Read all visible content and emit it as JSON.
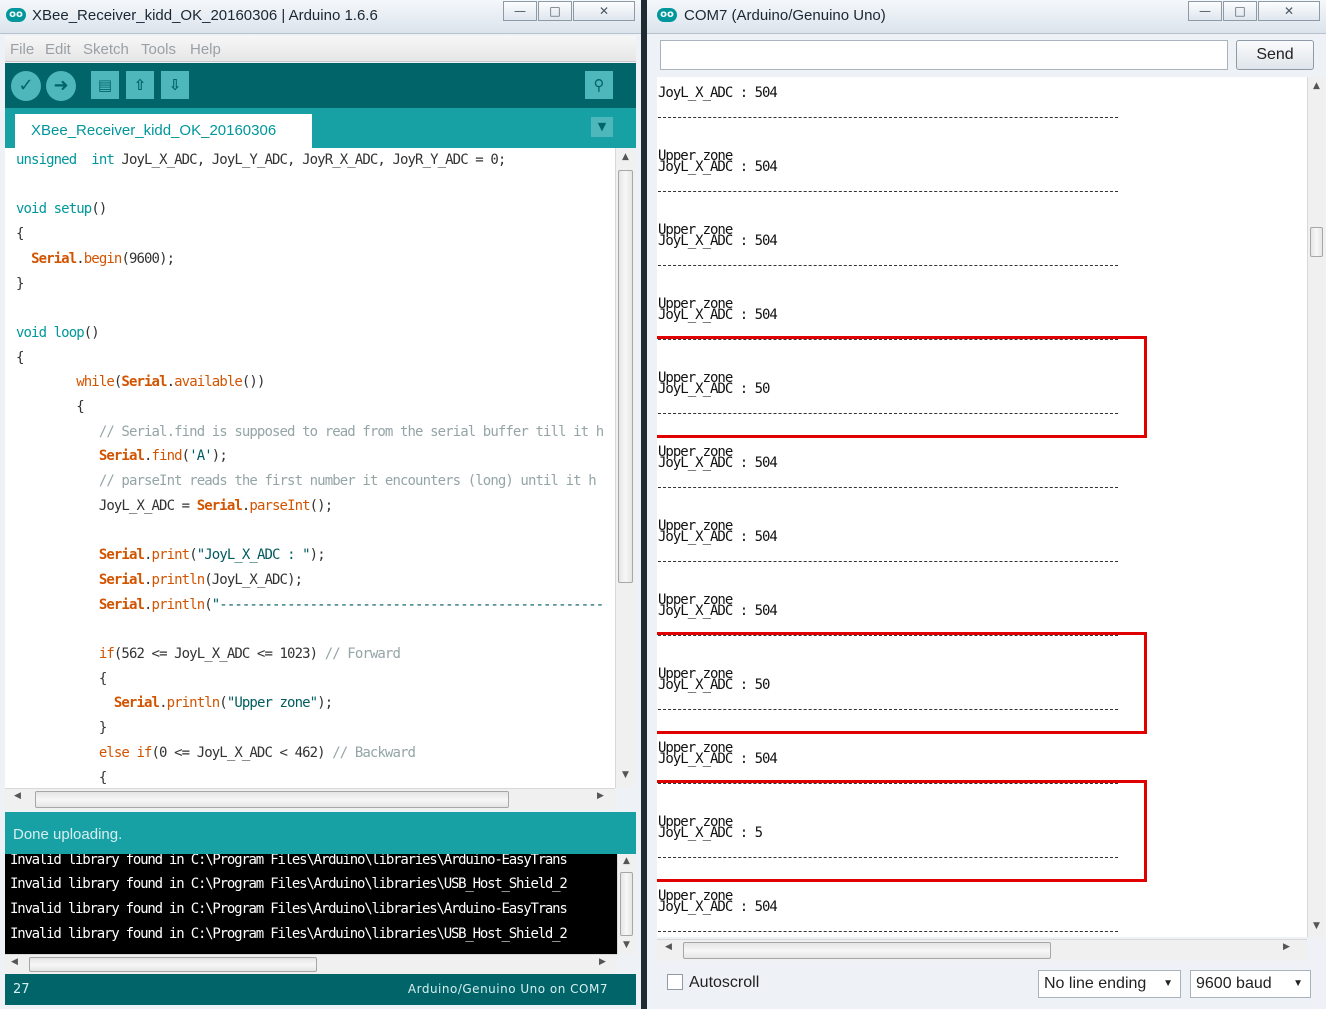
{
  "ide": {
    "title": "XBee_Receiver_kidd_OK_20160306 | Arduino 1.6.6",
    "logo": "oo",
    "menu": [
      "File",
      "Edit",
      "Sketch",
      "Tools",
      "Help"
    ],
    "toolbar_icons": [
      "verify-icon",
      "upload-icon",
      "new-icon",
      "open-icon",
      "save-icon",
      "serial-monitor-icon"
    ],
    "tab": "XBee_Receiver_kidd_OK_20160306",
    "code": [
      [
        [
          "kw",
          "unsigned"
        ],
        [
          "",
          "  "
        ],
        [
          "kw",
          "int"
        ],
        [
          "",
          " JoyL_X_ADC, JoyL_Y_ADC, JoyR_X_ADC, JoyR_Y_ADC = 0;"
        ]
      ],
      [],
      [
        [
          "kw",
          "void"
        ],
        [
          "",
          " "
        ],
        [
          "kw",
          "setup"
        ],
        [
          "",
          "()"
        ]
      ],
      [
        [
          "",
          "{"
        ]
      ],
      [
        [
          "",
          "  "
        ],
        [
          "obj",
          "Serial"
        ],
        [
          "",
          "."
        ],
        [
          "fn",
          "begin"
        ],
        [
          "",
          "(9600);"
        ]
      ],
      [
        [
          "",
          "}"
        ]
      ],
      [],
      [
        [
          "kw",
          "void"
        ],
        [
          "",
          " "
        ],
        [
          "kw",
          "loop"
        ],
        [
          "",
          "()"
        ]
      ],
      [
        [
          "",
          "{"
        ]
      ],
      [
        [
          "",
          "        "
        ],
        [
          "fn",
          "while"
        ],
        [
          "",
          "("
        ],
        [
          "obj",
          "Serial"
        ],
        [
          "",
          "."
        ],
        [
          "fn",
          "available"
        ],
        [
          "",
          "())"
        ]
      ],
      [
        [
          "",
          "        {"
        ]
      ],
      [
        [
          "",
          "           "
        ],
        [
          "cmt",
          "// Serial.find is supposed to read from the serial buffer till it h"
        ]
      ],
      [
        [
          "",
          "           "
        ],
        [
          "obj",
          "Serial"
        ],
        [
          "",
          "."
        ],
        [
          "fn",
          "find"
        ],
        [
          "",
          "("
        ],
        [
          "str",
          "'A'"
        ],
        [
          "",
          ");"
        ]
      ],
      [
        [
          "",
          "           "
        ],
        [
          "cmt",
          "// parseInt reads the first number it encounters (long) until it h"
        ]
      ],
      [
        [
          "",
          "           JoyL_X_ADC = "
        ],
        [
          "obj",
          "Serial"
        ],
        [
          "",
          "."
        ],
        [
          "fn",
          "parseInt"
        ],
        [
          "",
          "();"
        ]
      ],
      [],
      [
        [
          "",
          "           "
        ],
        [
          "obj",
          "Serial"
        ],
        [
          "",
          "."
        ],
        [
          "fn",
          "print"
        ],
        [
          "",
          "("
        ],
        [
          "str",
          "\"JoyL_X_ADC : \""
        ],
        [
          "",
          ");"
        ]
      ],
      [
        [
          "",
          "           "
        ],
        [
          "obj",
          "Serial"
        ],
        [
          "",
          "."
        ],
        [
          "fn",
          "println"
        ],
        [
          "",
          "(JoyL_X_ADC);"
        ]
      ],
      [
        [
          "",
          "           "
        ],
        [
          "obj",
          "Serial"
        ],
        [
          "",
          "."
        ],
        [
          "fn",
          "println"
        ],
        [
          "",
          "("
        ],
        [
          "str",
          "\"---------------------------------------------------"
        ]
      ],
      [],
      [
        [
          "",
          "           "
        ],
        [
          "fn",
          "if"
        ],
        [
          "",
          "(562 <= JoyL_X_ADC <= 1023) "
        ],
        [
          "cmt",
          "// Forward"
        ]
      ],
      [
        [
          "",
          "           {"
        ]
      ],
      [
        [
          "",
          "             "
        ],
        [
          "obj",
          "Serial"
        ],
        [
          "",
          "."
        ],
        [
          "fn",
          "println"
        ],
        [
          "",
          "("
        ],
        [
          "str",
          "\"Upper zone\""
        ],
        [
          "",
          ");"
        ]
      ],
      [
        [
          "",
          "           }"
        ]
      ],
      [
        [
          "",
          "           "
        ],
        [
          "fn",
          "else if"
        ],
        [
          "",
          "(0 <= JoyL_X_ADC < 462) "
        ],
        [
          "cmt",
          "// Backward"
        ]
      ],
      [
        [
          "",
          "           {"
        ]
      ]
    ],
    "status": "Done uploading.",
    "console": [
      "Invalid library found in C:\\Program Files\\Arduino\\libraries\\Arduino-EasyTrans",
      "Invalid library found in C:\\Program Files\\Arduino\\libraries\\USB_Host_Shield_2",
      "Invalid library found in C:\\Program Files\\Arduino\\libraries\\Arduino-EasyTrans",
      "Invalid library found in C:\\Program Files\\Arduino\\libraries\\USB_Host_Shield_2"
    ],
    "line_number": "27",
    "board": "Arduino/Genuino Uno on COM7"
  },
  "serial": {
    "title": "COM7 (Arduino/Genuino Uno)",
    "logo": "oo",
    "input_value": "",
    "send_label": "Send",
    "dash_text": "-----------------------------------------------------",
    "output": [
      {
        "zone": "",
        "adc": "JoyL_X_ADC : 504"
      },
      {
        "zone": "Upper zone",
        "adc": "JoyL_X_ADC : 504"
      },
      {
        "zone": "Upper zone",
        "adc": "JoyL_X_ADC : 504"
      },
      {
        "zone": "Upper zone",
        "adc": "JoyL_X_ADC : 504"
      },
      {
        "zone": "Upper zone",
        "adc": "JoyL_X_ADC : 50"
      },
      {
        "zone": "Upper zone",
        "adc": "JoyL_X_ADC : 504"
      },
      {
        "zone": "Upper zone",
        "adc": "JoyL_X_ADC : 504"
      },
      {
        "zone": "Upper zone",
        "adc": "JoyL_X_ADC : 504"
      },
      {
        "zone": "Upper zone",
        "adc": "JoyL_X_ADC : 50"
      },
      {
        "zone": "Upper zone",
        "adc": "JoyL_X_ADC : 504"
      },
      {
        "zone": "Upper zone",
        "adc": "JoyL_X_ADC : 5"
      },
      {
        "zone": "Upper zone",
        "adc": "JoyL_X_ADC : 504"
      }
    ],
    "highlighted_blocks": [
      4,
      8,
      10
    ],
    "autoscroll_label": "Autoscroll",
    "autoscroll_checked": false,
    "line_ending": "No line ending",
    "baud": "9600 baud"
  },
  "colors": {
    "teal_dark": "#006468",
    "teal": "#17a1a5",
    "highlight": "#e00000"
  }
}
